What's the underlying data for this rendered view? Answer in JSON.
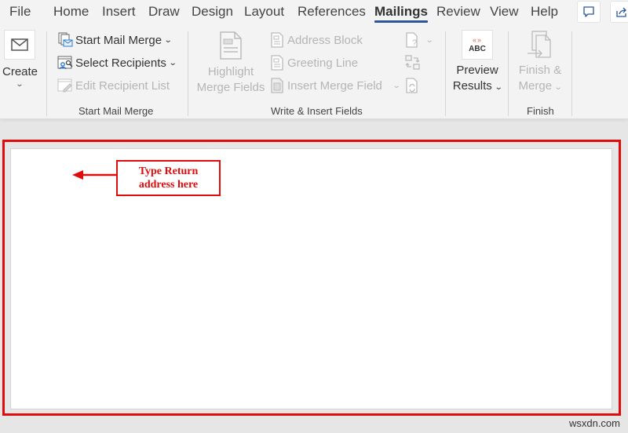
{
  "tabs": [
    {
      "label": "File",
      "active": false
    },
    {
      "label": "Home",
      "active": false
    },
    {
      "label": "Insert",
      "active": false
    },
    {
      "label": "Draw",
      "active": false
    },
    {
      "label": "Design",
      "active": false
    },
    {
      "label": "Layout",
      "active": false
    },
    {
      "label": "References",
      "active": false
    },
    {
      "label": "Mailings",
      "active": true
    },
    {
      "label": "Review",
      "active": false
    },
    {
      "label": "View",
      "active": false
    },
    {
      "label": "Help",
      "active": false
    }
  ],
  "corner_buttons": {
    "comments": "comment-icon",
    "share": "share-icon"
  },
  "ribbon": {
    "create": {
      "label": "Create",
      "icon": "envelope-icon"
    },
    "start_mail_merge": {
      "group_label": "Start Mail Merge",
      "items": [
        {
          "label": "Start Mail Merge",
          "icon": "start-mail-merge-icon",
          "dropdown": true,
          "enabled": true
        },
        {
          "label": "Select Recipients",
          "icon": "select-recipients-icon",
          "dropdown": true,
          "enabled": true
        },
        {
          "label": "Edit Recipient List",
          "icon": "edit-recipient-list-icon",
          "dropdown": false,
          "enabled": false
        }
      ]
    },
    "write_insert_fields": {
      "group_label": "Write & Insert Fields",
      "highlight": {
        "line1": "Highlight",
        "line2": "Merge Fields",
        "enabled": false
      },
      "items": [
        {
          "label": "Address Block",
          "icon": "address-block-icon",
          "enabled": false
        },
        {
          "label": "Greeting Line",
          "icon": "greeting-line-icon",
          "enabled": false
        },
        {
          "label": "Insert Merge Field",
          "icon": "insert-merge-field-icon",
          "enabled": false
        }
      ],
      "icon_buttons": [
        "rules-icon",
        "match-fields-icon",
        "update-labels-icon"
      ]
    },
    "preview": {
      "line1": "Preview",
      "line2": "Results",
      "icon_text": "ABC",
      "icon_marks": "«»"
    },
    "finish": {
      "group_label": "Finish",
      "line1": "Finish &",
      "line2": "Merge",
      "enabled": false
    }
  },
  "document": {
    "callout_line1": "Type Return",
    "callout_line2": "address here"
  },
  "colors": {
    "accent": "#2b579a",
    "annotation": "#e00b0b"
  },
  "watermark": "wsxdn.com"
}
